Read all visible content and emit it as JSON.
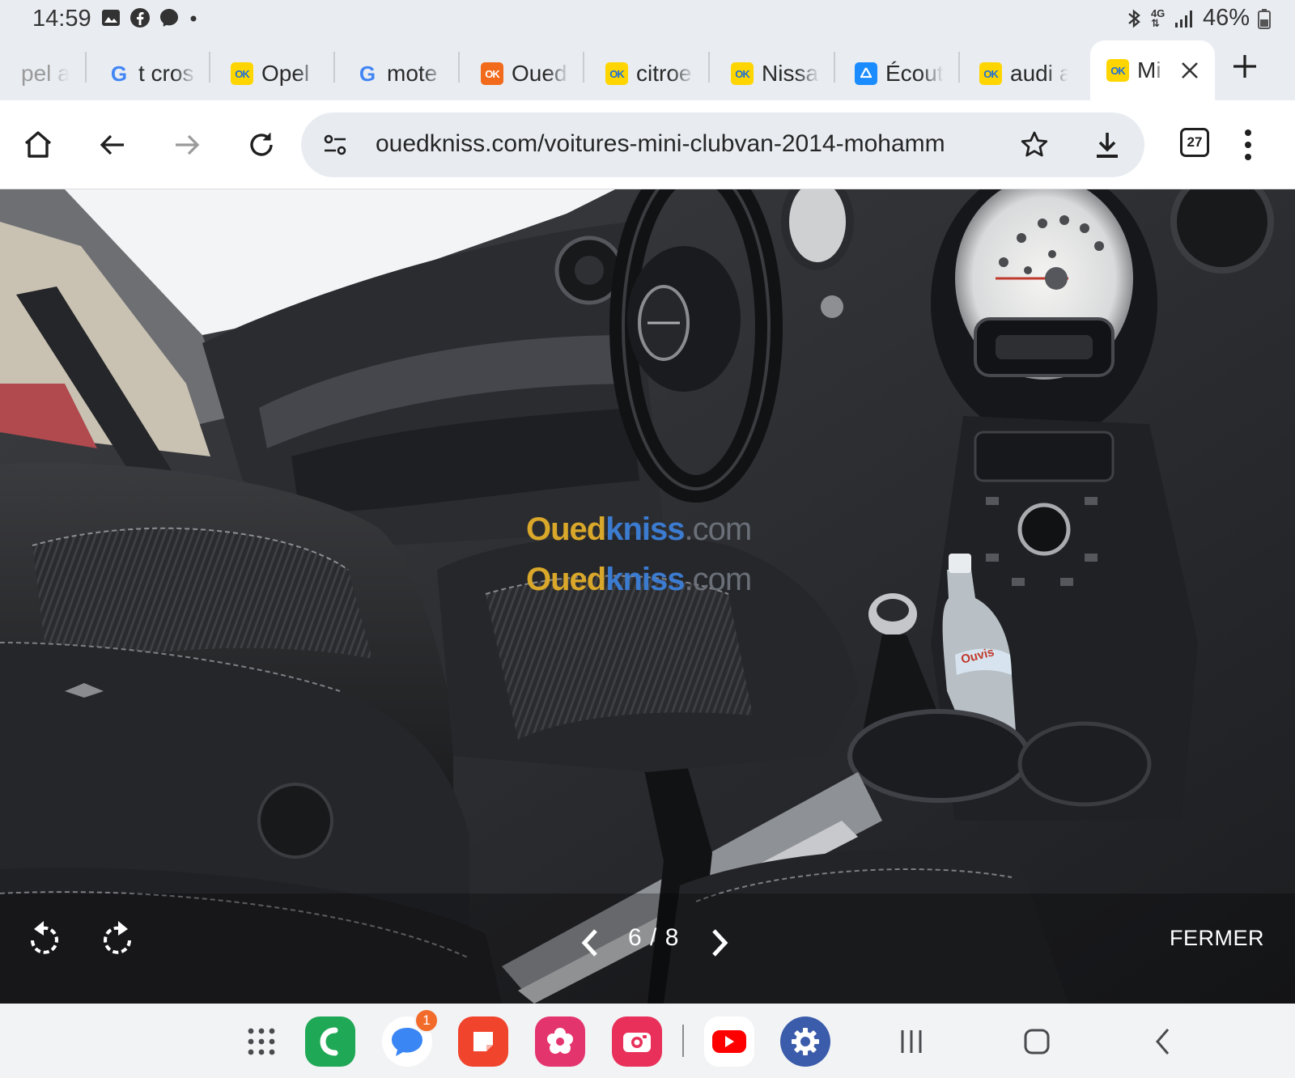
{
  "status_bar": {
    "time": "14:59",
    "notification_icons": [
      "gallery-icon",
      "facebook-icon",
      "messenger-icon",
      "dot-icon"
    ],
    "network": "4G",
    "battery": "46%"
  },
  "tabs": [
    {
      "label": "pel a",
      "favicon": "none"
    },
    {
      "label": "t cros",
      "favicon": "google"
    },
    {
      "label": "Opel",
      "favicon": "ouedkniss"
    },
    {
      "label": "mote",
      "favicon": "google"
    },
    {
      "label": "Oued",
      "favicon": "ouedkniss-orange"
    },
    {
      "label": "citroe",
      "favicon": "ouedkniss"
    },
    {
      "label": "Nissa",
      "favicon": "ouedkniss"
    },
    {
      "label": "Écout",
      "favicon": "app-store"
    },
    {
      "label": "audi a",
      "favicon": "ouedkniss"
    },
    {
      "label": "Mi",
      "favicon": "ouedkniss",
      "active": true
    }
  ],
  "favicon_text": {
    "ok": "OK",
    "google": "G"
  },
  "toolbar": {
    "url": "ouedkniss.com/voitures-mini-clubvan-2014-mohamm",
    "tab_count": "27"
  },
  "viewer": {
    "watermark": {
      "part1": "Oued",
      "part2": "kniss",
      "part3": ".com"
    },
    "counter": "6 / 8",
    "close_label": "FERMER",
    "bottle_label": "Ouvis"
  },
  "taskbar": {
    "apps": [
      "apps-grid",
      "phone",
      "messages",
      "notes",
      "blossom",
      "camera",
      "youtube",
      "settings"
    ],
    "messages_badge": "1"
  },
  "colors": {
    "chrome_bg": "#e9edf2",
    "toolbar_bg": "#ffffff",
    "omnibox_bg": "#e8ecf1",
    "ouedkniss_yellow": "#ffd500",
    "ouedkniss_blue": "#1d6fd6"
  }
}
